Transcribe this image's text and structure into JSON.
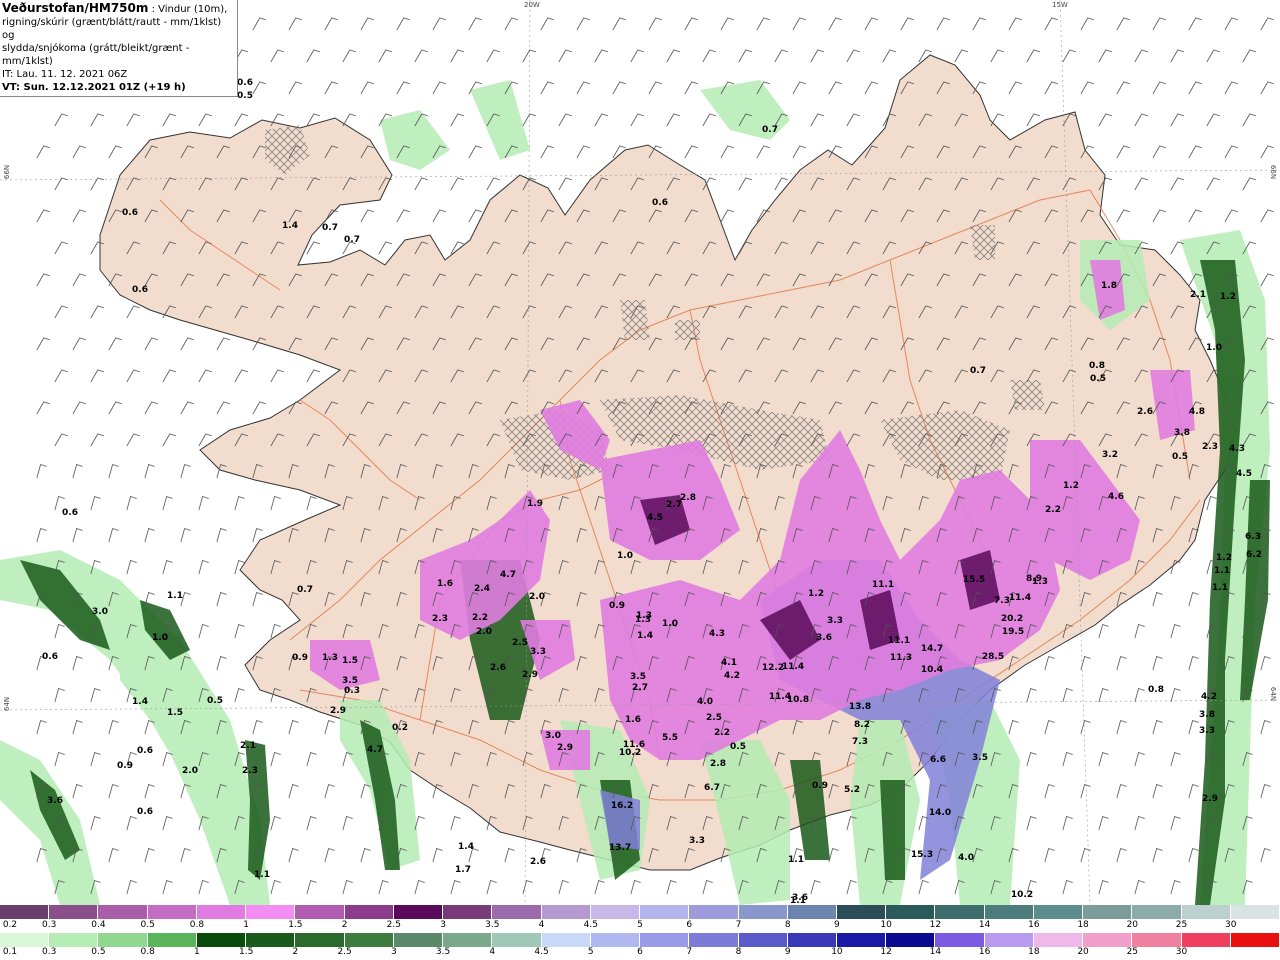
{
  "header": {
    "title": "Veðurstofan/HM750m",
    "desc_line1": ": Vindur (10m),",
    "desc_line2": "rigning/skúrir (grænt/blátt/rautt - mm/1klst) og",
    "desc_line3": "slydda/snjókoma (grátt/bleikt/grænt - mm/1klst)",
    "it_line": "IT: Lau. 11. 12. 2021 06Z",
    "vt_line": "VT: Sun. 12.12.2021 01Z (+19 h)"
  },
  "grid_labels": {
    "lon_20w": "20W",
    "lon_15w": "15W",
    "lat_66n_left": "66N",
    "lat_66n_right": "66N",
    "lat_64n_left": "64N",
    "lat_64n_right": "64N"
  },
  "colors": {
    "land": "#f2dccd",
    "sea": "#ffffff",
    "roads": "#e07a4a",
    "coast": "#333333",
    "wind_barb": "#555555"
  },
  "map_values": [
    "0.5",
    "0.6",
    "0.6",
    "0.6",
    "0.7",
    "0.7",
    "0.7",
    "0.6",
    "1.4",
    "0.6",
    "1.0",
    "3.0",
    "1.1",
    "1.0",
    "0.6",
    "1.4",
    "1.5",
    "0.5",
    "0.6",
    "0.9",
    "2.0",
    "3.6",
    "0.6",
    "2.1",
    "2.3",
    "1.1",
    "0.7",
    "0.9",
    "3.5",
    "0.3",
    "2.9",
    "4.7",
    "0.2",
    "1.5",
    "1.3",
    "1.6",
    "2.3",
    "2.4",
    "2.2",
    "2.0",
    "2.5",
    "3.3",
    "2.9",
    "2.6",
    "4.7",
    "2.0",
    "1.9",
    "2.8",
    "2.7",
    "4.5",
    "2.7",
    "1.0",
    "0.9",
    "1.3",
    "1.4",
    "1.3",
    "1.0",
    "4.3",
    "3.5",
    "4.1",
    "4.2",
    "4.0",
    "2.5",
    "2.2",
    "0.5",
    "2.8",
    "6.7",
    "3.0",
    "2.9",
    "1.6",
    "10.2",
    "11.6",
    "5.5",
    "16.2",
    "13.7",
    "3.3",
    "1.2",
    "3.3",
    "3.6",
    "11.1",
    "11.1",
    "11.3",
    "12.2",
    "11.4",
    "11.4",
    "10.8",
    "14.7",
    "10.4",
    "15.5",
    "20.2",
    "19.5",
    "28.5",
    "7.3",
    "11.4",
    "8.9",
    "13.8",
    "8.2",
    "7.3",
    "6.6",
    "15.3",
    "14.0",
    "3.5",
    "4.0",
    "10.2",
    "0.9",
    "5.2",
    "1.1",
    "3.6",
    "1.8",
    "2.1",
    "1.2",
    "2.3",
    "1.0",
    "3.2",
    "4.6",
    "2.6",
    "3.8",
    "4.8",
    "0.5",
    "1.2",
    "2.2",
    "1.3",
    "0.7",
    "0.8",
    "0.5",
    "4.3",
    "4.5",
    "6.3",
    "6.2",
    "1.2",
    "1.1",
    "1.1",
    "4.2",
    "3.8",
    "3.3",
    "2.9",
    "0.8",
    "1.4",
    "1.7",
    "2.6",
    "1.1"
  ],
  "legend_snow": {
    "ticks": [
      "0.2",
      "0.3",
      "0.4",
      "0.5",
      "0.8",
      "1",
      "1.5",
      "2",
      "2.5",
      "3",
      "3.5",
      "4",
      "4.5",
      "5",
      "6",
      "7",
      "8",
      "9",
      "10",
      "12",
      "14",
      "16",
      "18",
      "20",
      "25",
      "30"
    ],
    "colors": [
      "#6a3e6a",
      "#8a4e8a",
      "#a85ea8",
      "#c46cc4",
      "#e07ce0",
      "#f28ef2",
      "#b05ab0",
      "#8c3c8c",
      "#5a0a5a",
      "#7a3a7a",
      "#9a6aaa",
      "#b49ad0",
      "#c8b8e8",
      "#b4b4ec",
      "#9c9cdc",
      "#8898cc",
      "#6c84b0",
      "#2c4c58",
      "#2a5a5a",
      "#3c6c6c",
      "#4c7c7c",
      "#5c8c8c",
      "#7c9c9c",
      "#8cacac",
      "#bcd0d0",
      "#d8e4e4"
    ]
  },
  "legend_rain": {
    "ticks": [
      "0.1",
      "0.3",
      "0.5",
      "0.8",
      "1",
      "1.5",
      "2",
      "2.5",
      "3",
      "3.5",
      "4",
      "4.5",
      "5",
      "6",
      "7",
      "8",
      "9",
      "10",
      "12",
      "14",
      "16",
      "18",
      "20",
      "25",
      "30"
    ],
    "colors": [
      "#d8f8d8",
      "#b4ecb4",
      "#90d890",
      "#5ab45a",
      "#0a4a0a",
      "#1a5a1a",
      "#2a6a2a",
      "#3c7c3c",
      "#5a8a6a",
      "#7aa88a",
      "#a0c8b8",
      "#c8d8f8",
      "#b0b8f0",
      "#9a9ae8",
      "#7c7cd8",
      "#5a5ac8",
      "#3a3ab8",
      "#1a1aa8",
      "#0a0a90",
      "#7a5ae0",
      "#b89af0",
      "#f0b8e8",
      "#f0a0c8",
      "#f080a0",
      "#f04060",
      "#e81010"
    ]
  }
}
